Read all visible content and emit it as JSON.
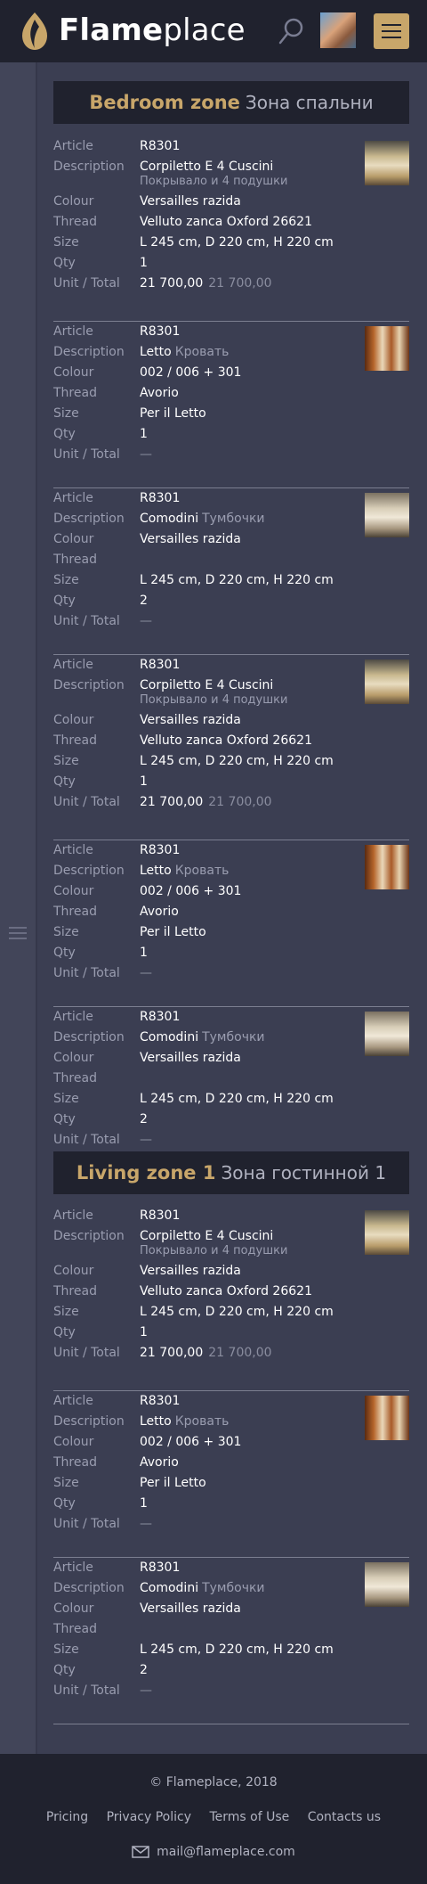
{
  "header": {
    "brand_bold": "Flame",
    "brand_light": "place"
  },
  "labels": {
    "article": "Article",
    "description": "Description",
    "colour": "Colour",
    "thread": "Thread",
    "size": "Size",
    "qty": "Qty",
    "unit_total": "Unit / Total"
  },
  "zones": [
    {
      "en": "Bedroom zone",
      "ru": "Зона спальни"
    },
    {
      "en": "Living zone 1",
      "ru": "Зона гостинной 1"
    }
  ],
  "items": [
    {
      "article": "R8301",
      "desc_main": "Corpiletto E 4 Cuscini",
      "desc_sub": "Покрывало и 4 подушки",
      "colour": "Versailles razida",
      "thread": "Velluto zanca Oxford 26621",
      "size": "L 245 cm, D 220 cm, H 220 cm",
      "qty": "1",
      "unit": "21 700,00",
      "total": "21 700,00",
      "thumb": "bedspread-image"
    },
    {
      "article": "R8301",
      "desc_main": "Letto",
      "desc_sub": "Кровать",
      "colour": "002 / 006 + 301",
      "thread": "Avorio",
      "size": "Per il Letto",
      "qty": "1",
      "unit": "—",
      "total": "",
      "thumb": "bed-image"
    },
    {
      "article": "R8301",
      "desc_main": "Comodini",
      "desc_sub": "Тумбочки",
      "colour": "Versailles razida",
      "thread": "",
      "size": "L 245 cm, D 220 cm, H 220 cm",
      "qty": "2",
      "unit": "—",
      "total": "",
      "thumb": "nightstand-image"
    },
    {
      "article": "R8301",
      "desc_main": "Corpiletto E 4 Cuscini",
      "desc_sub": "Покрывало и 4 подушки",
      "colour": "Versailles razida",
      "thread": "Velluto zanca Oxford 26621",
      "size": "L 245 cm, D 220 cm, H 220 cm",
      "qty": "1",
      "unit": "21 700,00",
      "total": "21 700,00",
      "thumb": "bedspread-image"
    },
    {
      "article": "R8301",
      "desc_main": "Letto",
      "desc_sub": "Кровать",
      "colour": "002 / 006 + 301",
      "thread": "Avorio",
      "size": "Per il Letto",
      "qty": "1",
      "unit": "—",
      "total": "",
      "thumb": "bed-image"
    },
    {
      "article": "R8301",
      "desc_main": "Comodini",
      "desc_sub": "Тумбочки",
      "colour": "Versailles razida",
      "thread": "",
      "size": "L 245 cm, D 220 cm, H 220 cm",
      "qty": "2",
      "unit": "—",
      "total": "",
      "thumb": "nightstand-image"
    },
    {
      "article": "R8301",
      "desc_main": "Corpiletto E 4 Cuscini",
      "desc_sub": "Покрывало и 4 подушки",
      "colour": "Versailles razida",
      "thread": "Velluto zanca Oxford 26621",
      "size": "L 245 cm, D 220 cm, H 220 cm",
      "qty": "1",
      "unit": "21 700,00",
      "total": "21 700,00",
      "thumb": "bedspread-image"
    },
    {
      "article": "R8301",
      "desc_main": "Letto",
      "desc_sub": "Кровать",
      "colour": "002 / 006 + 301",
      "thread": "Avorio",
      "size": "Per il Letto",
      "qty": "1",
      "unit": "—",
      "total": "",
      "thumb": "bed-image"
    },
    {
      "article": "R8301",
      "desc_main": "Comodini",
      "desc_sub": "Тумбочки",
      "colour": "Versailles razida",
      "thread": "",
      "size": "L 245 cm, D 220 cm, H 220 cm",
      "qty": "2",
      "unit": "—",
      "total": "",
      "thumb": "nightstand-image"
    }
  ],
  "footer": {
    "copyright": "© Flameplace, 2018",
    "links": [
      "Pricing",
      "Privacy Policy",
      "Terms of Use",
      "Contacts us"
    ],
    "email": "mail@flameplace.com"
  },
  "colors": {
    "accent": "#c8a66a",
    "header_bg": "#20222e",
    "page_bg": "#3b3e52"
  }
}
